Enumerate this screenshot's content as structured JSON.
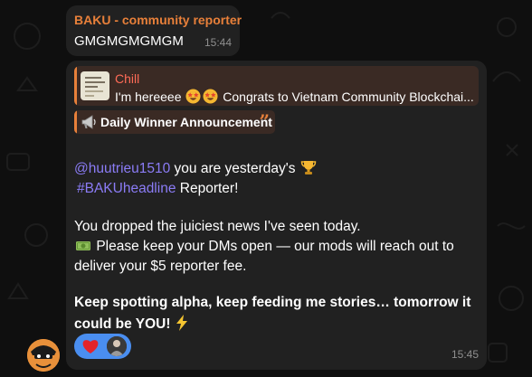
{
  "message1": {
    "sender": "BAKU - community reporter",
    "text": "GMGMGMGMGM",
    "time": "15:44"
  },
  "message2": {
    "reply": {
      "name": "Chill",
      "text_before_emoji": "I'm hereeee",
      "text_after_emoji": "Congrats to Vietnam Community Blockchai..."
    },
    "announcement": "Daily Winner Announcement",
    "line1_mention": "@huutrieu1510",
    "line1_text": "you are yesterday's",
    "line2_hashtag": "#BAKUheadline",
    "line2_text": "Reporter!",
    "line3": "You dropped the juiciest news I've seen today.",
    "line4": "Please keep your DMs open — our mods will reach out to",
    "line5": "deliver your $5 reporter fee.",
    "line6": "Keep spotting alpha, keep feeding me stories… tomorrow it",
    "line7": "could be YOU!",
    "time": "15:45"
  },
  "icons": {
    "reply_emoji": "star-struck-emoji",
    "announce": "megaphone-icon",
    "trophy": "trophy-emoji",
    "money": "money-emoji",
    "zap": "lightning-emoji",
    "reaction": "heart-emoji"
  },
  "colors": {
    "sender": "#e8803a",
    "reply_name": "#ff6b57",
    "mention": "#8b7cf6",
    "reaction_pill": "#4a8ef0"
  }
}
